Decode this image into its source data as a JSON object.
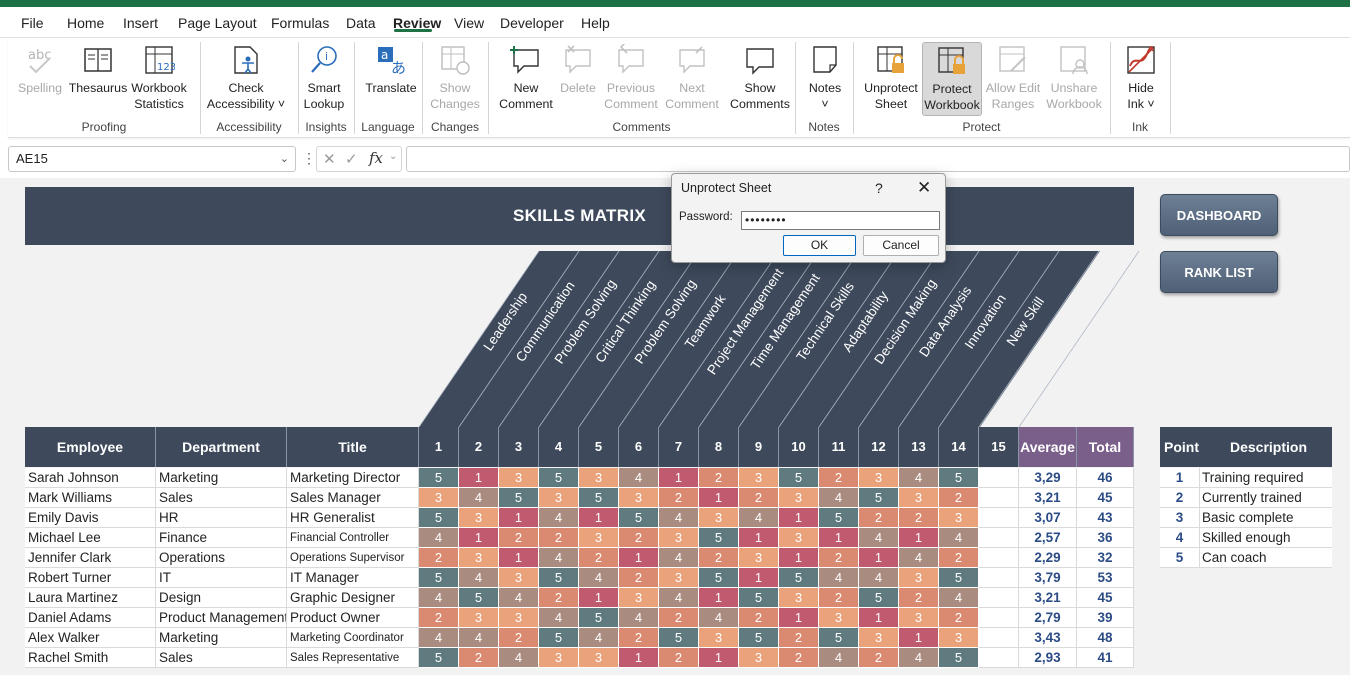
{
  "menu": {
    "items": [
      "File",
      "Home",
      "Insert",
      "Page Layout",
      "Formulas",
      "Data",
      "Review",
      "View",
      "Developer",
      "Help"
    ],
    "active": "Review"
  },
  "ribbon": {
    "buttons": [
      {
        "label": "Spelling",
        "icon": "spelling-icon",
        "disabled": true
      },
      {
        "label": "Thesaurus",
        "icon": "thesaurus-icon"
      },
      {
        "label": "Workbook\nStatistics",
        "icon": "workbook-statistics-icon"
      },
      {
        "label": "Check\nAccessibility ˅",
        "icon": "accessibility-icon"
      },
      {
        "label": "Smart\nLookup",
        "icon": "smart-lookup-icon"
      },
      {
        "label": "Translate",
        "icon": "translate-icon"
      },
      {
        "label": "Show\nChanges",
        "icon": "show-changes-icon",
        "disabled": true
      },
      {
        "label": "New\nComment",
        "icon": "new-comment-icon"
      },
      {
        "label": "Delete",
        "icon": "delete-comment-icon",
        "disabled": true
      },
      {
        "label": "Previous\nComment",
        "icon": "previous-comment-icon",
        "disabled": true
      },
      {
        "label": "Next\nComment",
        "icon": "next-comment-icon",
        "disabled": true
      },
      {
        "label": "Show\nComments",
        "icon": "show-comments-icon"
      },
      {
        "label": "Notes\n˅",
        "icon": "notes-icon"
      },
      {
        "label": "Unprotect\nSheet",
        "icon": "unprotect-sheet-icon"
      },
      {
        "label": "Protect\nWorkbook",
        "icon": "protect-workbook-icon",
        "selected": true
      },
      {
        "label": "Allow Edit\nRanges",
        "icon": "allow-edit-ranges-icon",
        "disabled": true
      },
      {
        "label": "Unshare\nWorkbook",
        "icon": "unshare-workbook-icon",
        "disabled": true
      },
      {
        "label": "Hide\nInk ˅",
        "icon": "hide-ink-icon"
      }
    ],
    "groups": [
      "Proofing",
      "Accessibility",
      "Insights",
      "Language",
      "Changes",
      "Comments",
      "Notes",
      "Protect",
      "Ink"
    ]
  },
  "formula_bar": {
    "name_box": "AE15",
    "fx": "fx",
    "formula": ""
  },
  "sheet": {
    "title": "SKILLS MATRIX",
    "buttons": [
      "DASHBOARD",
      "RANK LIST"
    ],
    "skills": [
      "Leadership",
      "Communication",
      "Problem Solving",
      "Critical Thinking",
      "Problem Solving",
      "Teamwork",
      "Project Management",
      "Time Management",
      "Technical Skills",
      "Adaptability",
      "Decision Making",
      "Data Analysis",
      "Innovation",
      "New Skill"
    ],
    "headers": {
      "employee": "Employee",
      "department": "Department",
      "title": "Title",
      "skill_numbers": [
        "1",
        "2",
        "3",
        "4",
        "5",
        "6",
        "7",
        "8",
        "9",
        "10",
        "11",
        "12",
        "13",
        "14",
        "15"
      ],
      "average": "Average",
      "total": "Total"
    },
    "rows": [
      {
        "employee": "Sarah Johnson",
        "department": "Marketing",
        "title": "Marketing Director",
        "scores": [
          5,
          1,
          3,
          5,
          3,
          4,
          1,
          2,
          3,
          5,
          2,
          3,
          4,
          5
        ],
        "average": "3,29",
        "total": "46"
      },
      {
        "employee": "Mark Williams",
        "department": "Sales",
        "title": "Sales Manager",
        "scores": [
          3,
          4,
          5,
          3,
          5,
          3,
          2,
          1,
          2,
          3,
          4,
          5,
          3,
          2
        ],
        "average": "3,21",
        "total": "45"
      },
      {
        "employee": "Emily Davis",
        "department": "HR",
        "title": "HR Generalist",
        "scores": [
          5,
          3,
          1,
          4,
          1,
          5,
          4,
          3,
          4,
          1,
          5,
          2,
          2,
          3
        ],
        "average": "3,07",
        "total": "43"
      },
      {
        "employee": "Michael Lee",
        "department": "Finance",
        "title": "Financial Controller",
        "scores": [
          4,
          1,
          2,
          2,
          3,
          2,
          3,
          5,
          1,
          3,
          1,
          4,
          1,
          4
        ],
        "average": "2,57",
        "total": "36"
      },
      {
        "employee": "Jennifer Clark",
        "department": "Operations",
        "title": "Operations Supervisor",
        "scores": [
          2,
          3,
          1,
          4,
          2,
          1,
          4,
          2,
          3,
          1,
          2,
          1,
          4,
          2
        ],
        "average": "2,29",
        "total": "32"
      },
      {
        "employee": "Robert Turner",
        "department": "IT",
        "title": "IT Manager",
        "scores": [
          5,
          4,
          3,
          5,
          4,
          2,
          3,
          5,
          1,
          5,
          4,
          4,
          3,
          5
        ],
        "average": "3,79",
        "total": "53"
      },
      {
        "employee": "Laura Martinez",
        "department": "Design",
        "title": "Graphic Designer",
        "scores": [
          4,
          5,
          4,
          2,
          1,
          3,
          4,
          1,
          5,
          3,
          2,
          5,
          2,
          4
        ],
        "average": "3,21",
        "total": "45"
      },
      {
        "employee": "Daniel Adams",
        "department": "Product Management",
        "title": "Product Owner",
        "scores": [
          2,
          3,
          3,
          4,
          5,
          4,
          2,
          4,
          2,
          1,
          3,
          1,
          3,
          2
        ],
        "average": "2,79",
        "total": "39"
      },
      {
        "employee": "Alex Walker",
        "department": "Marketing",
        "title": "Marketing Coordinator",
        "scores": [
          4,
          4,
          2,
          5,
          4,
          2,
          5,
          3,
          5,
          2,
          5,
          3,
          1,
          3
        ],
        "average": "3,43",
        "total": "48"
      },
      {
        "employee": "Rachel Smith",
        "department": "Sales",
        "title": "Sales Representative",
        "scores": [
          5,
          2,
          4,
          3,
          3,
          1,
          2,
          1,
          3,
          2,
          4,
          2,
          4,
          5
        ],
        "average": "2,93",
        "total": "41"
      }
    ],
    "legend": {
      "headers": [
        "Point",
        "Description"
      ],
      "items": [
        {
          "point": "1",
          "desc": "Training required"
        },
        {
          "point": "2",
          "desc": "Currently trained"
        },
        {
          "point": "3",
          "desc": "Basic complete"
        },
        {
          "point": "4",
          "desc": "Skilled enough"
        },
        {
          "point": "5",
          "desc": "Can coach"
        }
      ]
    },
    "score_colors": {
      "1": "#c05a6e",
      "2": "#db8a72",
      "3": "#e9a27a",
      "4": "#a98b80",
      "5": "#5f7b80"
    },
    "header_color": "#3e4a5c",
    "average_header_color": "#7b5f8b"
  },
  "dialog": {
    "title": "Unprotect Sheet",
    "help": "?",
    "close": "✕",
    "password_label": "Password:",
    "password_value": "••••••••",
    "ok": "OK",
    "cancel": "Cancel"
  }
}
